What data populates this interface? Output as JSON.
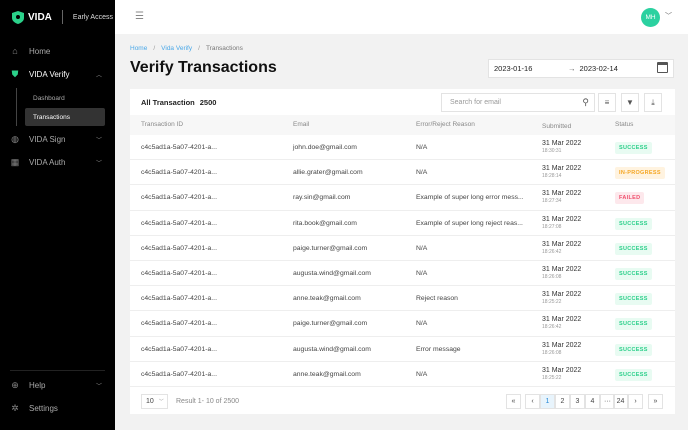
{
  "sidebar": {
    "logo": "VIDA",
    "badge": "Early Access",
    "items": [
      {
        "label": "Home",
        "icon": "home-icon"
      },
      {
        "label": "VIDA Verify",
        "icon": "shield-check-icon"
      },
      {
        "label": "VIDA Sign",
        "icon": "fingerprint-icon"
      },
      {
        "label": "VIDA Auth",
        "icon": "id-card-icon"
      }
    ],
    "subitems": [
      {
        "label": "Dashboard"
      },
      {
        "label": "Transactions"
      }
    ],
    "bottom": [
      {
        "label": "Help",
        "icon": "lifebuoy-icon"
      },
      {
        "label": "Settings",
        "icon": "gear-icon"
      }
    ]
  },
  "topbar": {
    "avatar": "MH"
  },
  "breadcrumb": [
    "Home",
    "Vida Verify",
    "Transactions"
  ],
  "page_title": "Verify Transactions",
  "date_range": {
    "start": "2023-01-16",
    "end": "2023-02-14"
  },
  "card": {
    "title": "All Transaction",
    "count": "2500",
    "search_placeholder": "Search for email"
  },
  "columns": [
    "Transaction ID",
    "Email",
    "Error/Reject Reason",
    "Submitted",
    "Status"
  ],
  "rows": [
    {
      "id": "c4c5ad1a-5a07-4201-a...",
      "email": "john.doe@gmail.com",
      "reason": "N/A",
      "date": "31 Mar 2022",
      "time": "18:30:31",
      "status": "SUCCESS"
    },
    {
      "id": "c4c5ad1a-5a07-4201-a...",
      "email": "allie.grater@gmail.com",
      "reason": "N/A",
      "date": "31 Mar 2022",
      "time": "18:28:14",
      "status": "IN-PROGRESS"
    },
    {
      "id": "c4c5ad1a-5a07-4201-a...",
      "email": "ray.sin@gmail.com",
      "reason": "Example of super long error mess...",
      "date": "31 Mar 2022",
      "time": "18:27:34",
      "status": "FAILED"
    },
    {
      "id": "c4c5ad1a-5a07-4201-a...",
      "email": "rita.book@gmail.com",
      "reason": "Example of super long reject reas...",
      "date": "31 Mar 2022",
      "time": "18:27:08",
      "status": "SUCCESS"
    },
    {
      "id": "c4c5ad1a-5a07-4201-a...",
      "email": "paige.turner@gmail.com",
      "reason": "N/A",
      "date": "31 Mar 2022",
      "time": "18:26:42",
      "status": "SUCCESS"
    },
    {
      "id": "c4c5ad1a-5a07-4201-a...",
      "email": "augusta.wind@gmail.com",
      "reason": "N/A",
      "date": "31 Mar 2022",
      "time": "18:26:08",
      "status": "SUCCESS"
    },
    {
      "id": "c4c5ad1a-5a07-4201-a...",
      "email": "anne.teak@gmail.com",
      "reason": "Reject reason",
      "date": "31 Mar 2022",
      "time": "18:25:22",
      "status": "SUCCESS"
    },
    {
      "id": "c4c5ad1a-5a07-4201-a...",
      "email": "paige.turner@gmail.com",
      "reason": "N/A",
      "date": "31 Mar 2022",
      "time": "18:26:42",
      "status": "SUCCESS"
    },
    {
      "id": "c4c5ad1a-5a07-4201-a...",
      "email": "augusta.wind@gmail.com",
      "reason": "Error message",
      "date": "31 Mar 2022",
      "time": "18:26:08",
      "status": "SUCCESS"
    },
    {
      "id": "c4c5ad1a-5a07-4201-a...",
      "email": "anne.teak@gmail.com",
      "reason": "N/A",
      "date": "31 Mar 2022",
      "time": "18:25:22",
      "status": "SUCCESS"
    }
  ],
  "status_colors": {
    "SUCCESS": {
      "fg": "#2bcf8a",
      "bg": "#e8fbf2"
    },
    "IN-PROGRESS": {
      "fg": "#f5a623",
      "bg": "#fff3e0"
    },
    "FAILED": {
      "fg": "#f0506e",
      "bg": "#fde8ec"
    }
  },
  "footer": {
    "per_page": "10",
    "result": "Result 1- 10 of 2500",
    "pages": [
      "1",
      "2",
      "3",
      "4",
      "···",
      "24"
    ],
    "current_page": "1"
  }
}
